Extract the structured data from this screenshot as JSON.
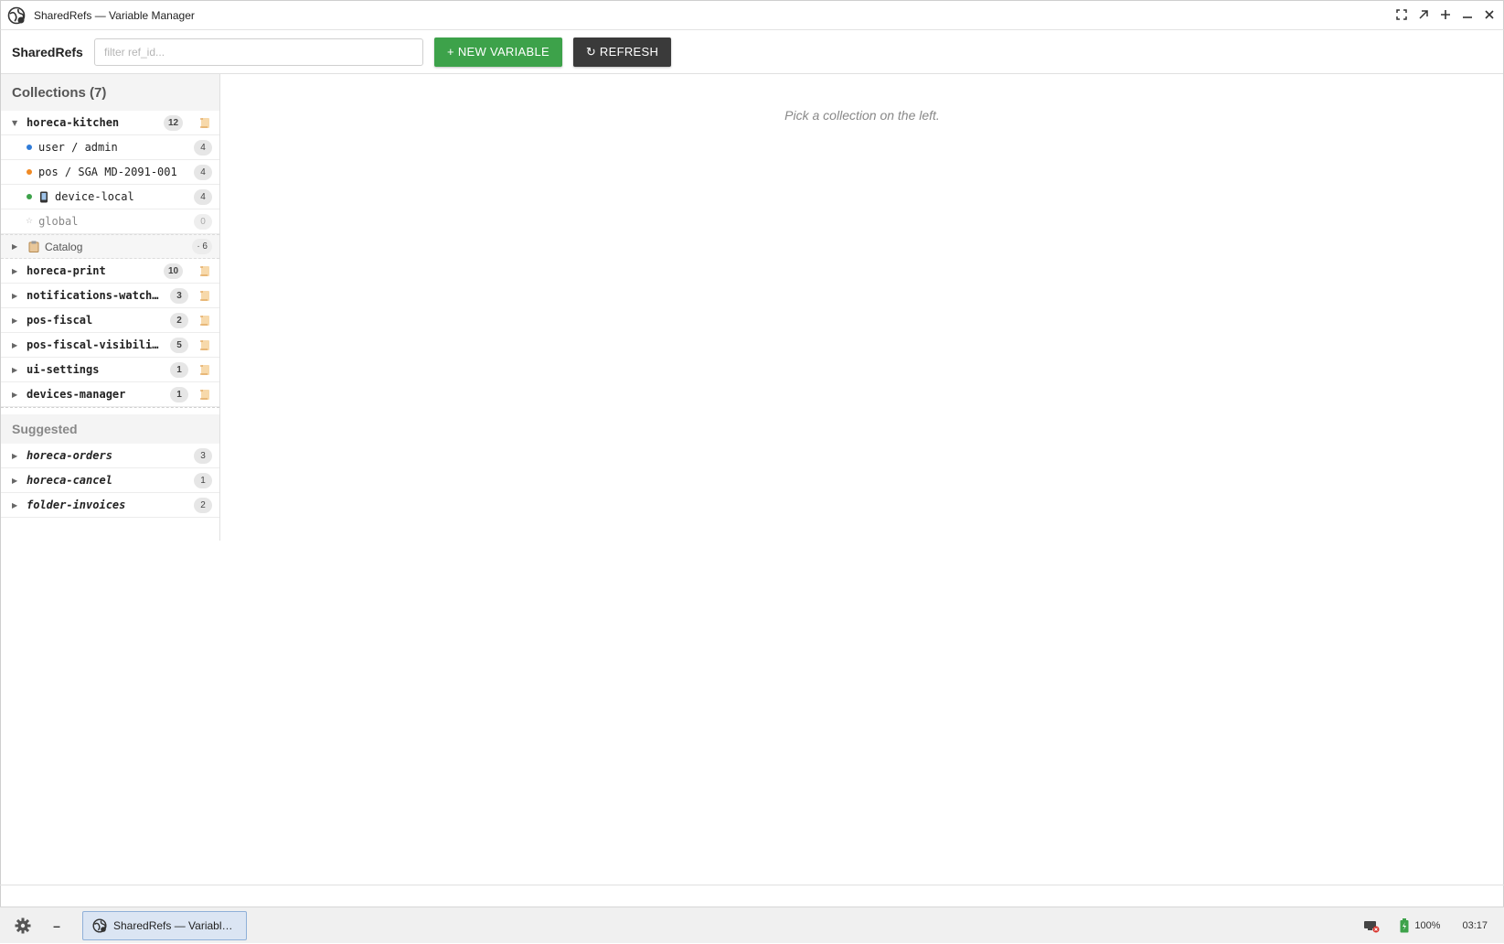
{
  "window": {
    "title": "SharedRefs — Variable Manager"
  },
  "toolbar": {
    "brand": "SharedRefs",
    "filter_placeholder": "filter ref_id...",
    "new_label": "+ NEW VARIABLE",
    "refresh_label": "↻ REFRESH"
  },
  "collections": {
    "header": "Collections (7)",
    "items": [
      {
        "name": "horeca-kitchen",
        "count": "12",
        "expanded": true,
        "children": [
          {
            "label": "user / admin",
            "count": "4",
            "color": "#2f7bd8"
          },
          {
            "label": "pos / SGA MD-2091-001",
            "count": "4",
            "color": "#f08a24"
          },
          {
            "label": "device-local",
            "count": "4",
            "color": "#3da24a",
            "icon": "mobile-phone-icon"
          },
          {
            "label": "global",
            "count": "0",
            "color": "#cccccc",
            "icon": "star-outline-icon"
          }
        ],
        "catalog": {
          "label": "Catalog",
          "count": "· 6",
          "icon": "clipboard-icon"
        }
      },
      {
        "name": "horeca-print",
        "count": "10"
      },
      {
        "name": "notifications-watch…",
        "count": "3"
      },
      {
        "name": "pos-fiscal",
        "count": "2"
      },
      {
        "name": "pos-fiscal-visibili…",
        "count": "5"
      },
      {
        "name": "ui-settings",
        "count": "1"
      },
      {
        "name": "devices-manager",
        "count": "1"
      }
    ]
  },
  "suggested": {
    "header": "Suggested",
    "items": [
      {
        "name": "horeca-orders",
        "count": "3"
      },
      {
        "name": "horeca-cancel",
        "count": "1"
      },
      {
        "name": "folder-invoices",
        "count": "2"
      }
    ]
  },
  "main": {
    "hint": "Pick a collection on the left."
  },
  "taskbar": {
    "task_label": "SharedRefs — Variabl…",
    "battery": "100%",
    "clock": "03:17"
  },
  "colors": {
    "accent_green": "#3da24a",
    "dark_button": "#3a3a3a",
    "scroll_icon": "#f3c98b"
  }
}
